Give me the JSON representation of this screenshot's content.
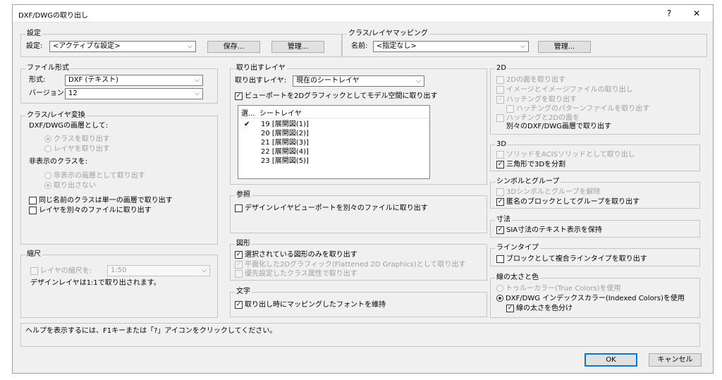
{
  "window": {
    "title": "DXF/DWGの取り出し",
    "help": "?",
    "close": "✕"
  },
  "settings": {
    "legend": "設定",
    "label": "設定:",
    "value": "<アクティブな設定>",
    "save": "保存...",
    "manage": "管理..."
  },
  "mapping": {
    "legend": "クラス/レイヤマッピング",
    "label": "名前:",
    "value": "<指定なし>",
    "manage": "管理..."
  },
  "filetype": {
    "legend": "ファイル形式",
    "format_label": "形式:",
    "format_value": "DXF (テキスト)",
    "version_label": "バージョン:",
    "version_value": "12"
  },
  "classlayer": {
    "legend": "クラス/レイヤ変換",
    "heading": "DXF/DWGの画層として:",
    "opt1": "クラスを取り出す",
    "opt2": "レイヤを取り出す",
    "hidden_label": "非表示のクラスを:",
    "hopt1": "非表示の画層として取り出す",
    "hopt2": "取り出さない",
    "chk1": "同じ名前のクラスは単一の画層で取り出す",
    "chk2": "レイヤを別々のファイルに取り出す"
  },
  "scale": {
    "legend": "縮尺",
    "chk": "レイヤの縮尺を:",
    "value": "1:50",
    "note": "デザインレイヤは1:1で取り出されます。"
  },
  "export_layers": {
    "legend": "取り出すレイヤ",
    "label": "取り出すレイヤ:",
    "value": "現在のシートレイヤ",
    "viewport_chk": "ビューポートを2Dグラフィックとしてモデル空間に取り出す",
    "col1": "選...",
    "col2": "シートレイヤ",
    "rows": [
      {
        "mark": "✔",
        "name": "19 [展開図(1)]"
      },
      {
        "mark": "",
        "name": "20 [展開図(2)]"
      },
      {
        "mark": "",
        "name": "21 [展開図(3)]"
      },
      {
        "mark": "",
        "name": "22 [展開図(4)]"
      },
      {
        "mark": "",
        "name": "23 [展開図(5)]"
      }
    ]
  },
  "reference": {
    "legend": "参照",
    "chk": "デザインレイヤビューポートを別々のファイルに取り出す"
  },
  "shapes": {
    "legend": "図形",
    "chk1": "選択されている図形のみを取り出す",
    "chk2": "平面化した2Dグラフィック(Flattened 2D Graphics)として取り出す",
    "chk3": "優先設定したクラス属性で取り出す"
  },
  "text": {
    "legend": "文字",
    "chk": "取り出し時にマッピングしたフォントを維持"
  },
  "twod": {
    "legend": "2D",
    "chk1": "2Dの面を取り出す",
    "chk2": "イメージとイメージファイルの取り出し",
    "chk3": "ハッチングを取り出す",
    "chk4": "ハッチングのパターンファイルを取り出す",
    "chk5a": "ハッチングと2Dの面を",
    "chk5b": "別々のDXF/DWG画層で取り出す"
  },
  "threed": {
    "legend": "3D",
    "chk1": "ソリッドをACISソリッドとして取り出し",
    "chk2": "三角形で3Dを分割"
  },
  "symbols": {
    "legend": "シンボルとグループ",
    "chk1": "3Dシンボルとグループを解除",
    "chk2": "匿名のブロックとしてグループを取り出す"
  },
  "dims": {
    "legend": "寸法",
    "chk": "SIA寸法のテキスト表示を保持"
  },
  "linetype": {
    "legend": "ラインタイプ",
    "chk": "ブロックとして複合ラインタイプを取り出す"
  },
  "lineweight": {
    "legend": "線の太さと色",
    "opt1": "トゥルーカラー(True Colors)を使用",
    "opt2": "DXF/DWG インデックスカラー(Indexed Colors)を使用",
    "chk": "線の太さを色分け"
  },
  "help_text": "ヘルプを表示するには、F1キーまたは「?」アイコンをクリックしてください。",
  "buttons": {
    "ok": "OK",
    "cancel": "キャンセル"
  }
}
